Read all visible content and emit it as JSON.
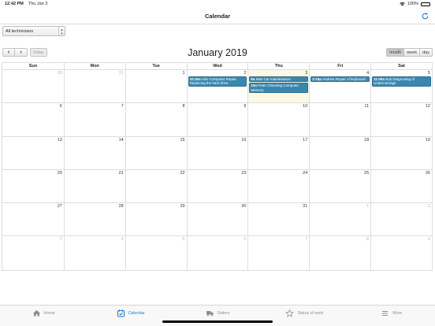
{
  "status_bar": {
    "time": "12:42 PM",
    "date": "Thu Jan 3",
    "battery": "100%"
  },
  "nav": {
    "title": "Calendar"
  },
  "filter": {
    "selected": "All technicians"
  },
  "toolbar": {
    "prev": "‹",
    "next": "›",
    "today": "today",
    "month_title": "January 2019",
    "views": [
      {
        "label": "month",
        "active": true
      },
      {
        "label": "week",
        "active": false
      },
      {
        "label": "day",
        "active": false
      }
    ]
  },
  "calendar": {
    "weekdays": [
      "Sun",
      "Mon",
      "Tue",
      "Wed",
      "Thu",
      "Fri",
      "Sat"
    ],
    "today_day": "3",
    "weeks": [
      [
        {
          "day": "30",
          "other": true,
          "events": []
        },
        {
          "day": "31",
          "other": true,
          "events": []
        },
        {
          "day": "1",
          "other": false,
          "events": []
        },
        {
          "day": "2",
          "other": false,
          "events": [
            {
              "time": "10:30a",
              "text": "Alex Computer Repair. Replacing the hard drive."
            }
          ]
        },
        {
          "day": "3",
          "other": false,
          "events": [
            {
              "time": "9a",
              "text": "Max Car maintenance"
            },
            {
              "time": "10a",
              "text": "Peter Checking Computer Memory"
            }
          ]
        },
        {
          "day": "4",
          "other": false,
          "events": [
            {
              "time": "2:15p",
              "text": "Andrew Repair of keyboard"
            }
          ]
        },
        {
          "day": "5",
          "other": false,
          "events": [
            {
              "time": "11:00a",
              "text": "Bob Diagnosing of Undercarriage"
            }
          ]
        }
      ],
      [
        {
          "day": "6",
          "other": false,
          "events": []
        },
        {
          "day": "7",
          "other": false,
          "events": []
        },
        {
          "day": "8",
          "other": false,
          "events": []
        },
        {
          "day": "9",
          "other": false,
          "events": []
        },
        {
          "day": "10",
          "other": false,
          "events": []
        },
        {
          "day": "11",
          "other": false,
          "events": []
        },
        {
          "day": "12",
          "other": false,
          "events": []
        }
      ],
      [
        {
          "day": "13",
          "other": false,
          "events": []
        },
        {
          "day": "14",
          "other": false,
          "events": []
        },
        {
          "day": "15",
          "other": false,
          "events": []
        },
        {
          "day": "16",
          "other": false,
          "events": []
        },
        {
          "day": "17",
          "other": false,
          "events": []
        },
        {
          "day": "18",
          "other": false,
          "events": []
        },
        {
          "day": "19",
          "other": false,
          "events": []
        }
      ],
      [
        {
          "day": "20",
          "other": false,
          "events": []
        },
        {
          "day": "21",
          "other": false,
          "events": []
        },
        {
          "day": "22",
          "other": false,
          "events": []
        },
        {
          "day": "23",
          "other": false,
          "events": []
        },
        {
          "day": "24",
          "other": false,
          "events": []
        },
        {
          "day": "25",
          "other": false,
          "events": []
        },
        {
          "day": "26",
          "other": false,
          "events": []
        }
      ],
      [
        {
          "day": "27",
          "other": false,
          "events": []
        },
        {
          "day": "28",
          "other": false,
          "events": []
        },
        {
          "day": "29",
          "other": false,
          "events": []
        },
        {
          "day": "30",
          "other": false,
          "events": []
        },
        {
          "day": "31",
          "other": false,
          "events": []
        },
        {
          "day": "1",
          "other": true,
          "events": []
        },
        {
          "day": "2",
          "other": true,
          "events": []
        }
      ],
      [
        {
          "day": "3",
          "other": true,
          "events": []
        },
        {
          "day": "4",
          "other": true,
          "events": []
        },
        {
          "day": "5",
          "other": true,
          "events": []
        },
        {
          "day": "6",
          "other": true,
          "events": []
        },
        {
          "day": "7",
          "other": true,
          "events": []
        },
        {
          "day": "8",
          "other": true,
          "events": []
        },
        {
          "day": "9",
          "other": true,
          "events": []
        }
      ]
    ]
  },
  "tabs": [
    {
      "label": "Home",
      "icon": "home-icon",
      "active": false
    },
    {
      "label": "Calendar",
      "icon": "calendar-icon",
      "active": true
    },
    {
      "label": "Orders",
      "icon": "truck-icon",
      "active": false
    },
    {
      "label": "Status of work",
      "icon": "star-icon",
      "active": false
    },
    {
      "label": "More",
      "icon": "more-icon",
      "active": false
    }
  ],
  "colors": {
    "accent": "#1a7ad9",
    "event": "#3a87ad",
    "today_bg": "#fcf8e3"
  }
}
